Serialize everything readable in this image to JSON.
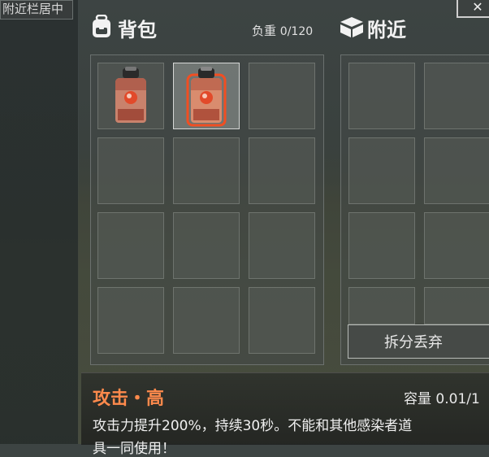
{
  "background_tab": {
    "label": "附近栏居中"
  },
  "backpack": {
    "title": "背包",
    "icon": "backpack-icon",
    "weight_label": "负重",
    "weight_value": "0/120",
    "slots_count": 12,
    "items": [
      {
        "slot": 0,
        "name": "攻击·高",
        "icon": "orange-potion-bottle-icon",
        "selected": false
      },
      {
        "slot": 1,
        "name": "攻击·高",
        "icon": "orange-potion-bottle-icon",
        "selected": true
      }
    ]
  },
  "nearby": {
    "title": "附近",
    "icon": "boxes-icon",
    "discard_button": "拆分丢弃"
  },
  "item_detail": {
    "name": "攻击・高",
    "capacity_label": "容量",
    "capacity_value": "0.01/1",
    "description_line1": "攻击力提升200%，持续30秒。不能和其他感染者道",
    "description_line2": "具一同使用！"
  },
  "colors": {
    "accent_orange": "#ff8a4c",
    "selection_glow": "#ff4a1a"
  }
}
